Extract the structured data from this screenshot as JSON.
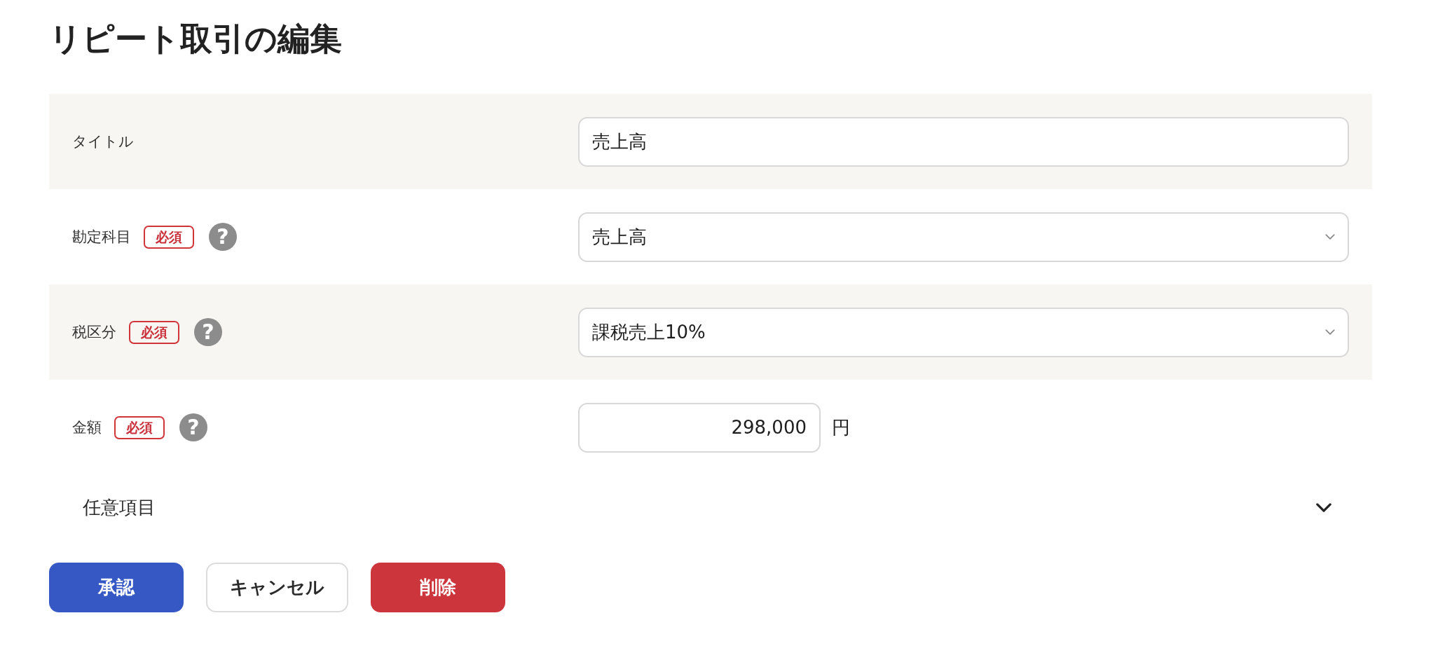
{
  "page": {
    "title": "リピート取引の編集"
  },
  "fields": [
    {
      "kind": "text",
      "label": "タイトル",
      "value": "売上高"
    },
    {
      "kind": "select",
      "label": "勘定科目",
      "badge": "必須",
      "help_icon": "?",
      "value": "売上高"
    },
    {
      "kind": "select",
      "label": "税区分",
      "badge": "必須",
      "help_icon": "?",
      "value": "課税売上10%"
    },
    {
      "kind": "amount",
      "label": "金額",
      "badge": "必須",
      "help_icon": "?",
      "value": "298,000",
      "unit": "円"
    }
  ],
  "optional_section": {
    "label": "任意項目",
    "expanded": false
  },
  "buttons": [
    {
      "label": "承認",
      "kind": "primary"
    },
    {
      "label": "キャンセル",
      "kind": "secondary"
    },
    {
      "label": "削除",
      "kind": "danger"
    }
  ]
}
